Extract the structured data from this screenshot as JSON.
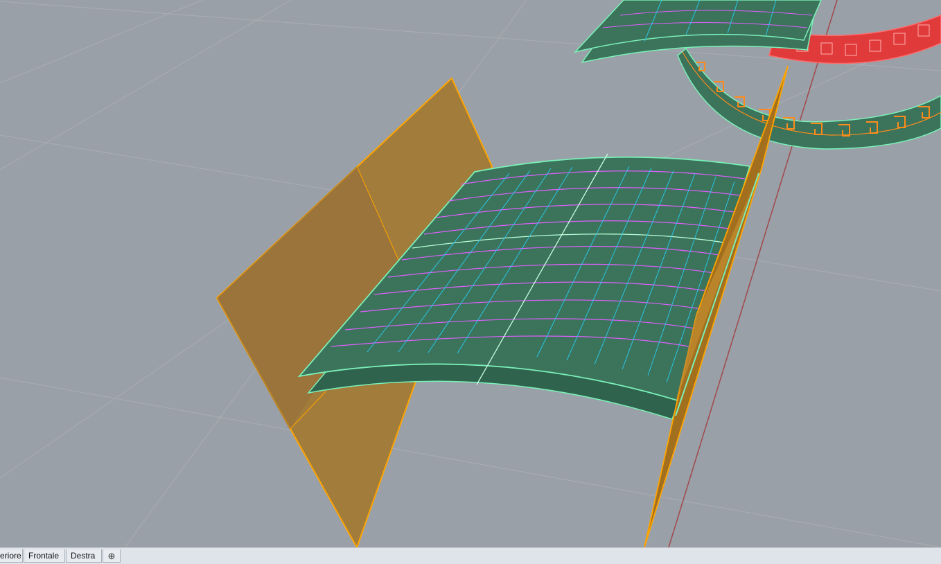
{
  "viewport": {
    "background": "#9aa0a7",
    "grid_color": "#a7adb3",
    "surface_fill": "#3b735b",
    "surface_edge": "#7bf0b8",
    "iso_u_color": "#e060ff",
    "iso_v_color": "#29c7e6",
    "plane_fill": "#a27c3a",
    "plane_edge": "#ffa500",
    "ring_red": "#e03a3a",
    "ring_orange": "#ff8c1a",
    "axis_color": "#a0484a"
  },
  "tabs": {
    "items": [
      {
        "label": "eriore"
      },
      {
        "label": "Frontale"
      },
      {
        "label": "Destra"
      }
    ],
    "add_icon": "plus-icon",
    "add_glyph": "⊕"
  }
}
